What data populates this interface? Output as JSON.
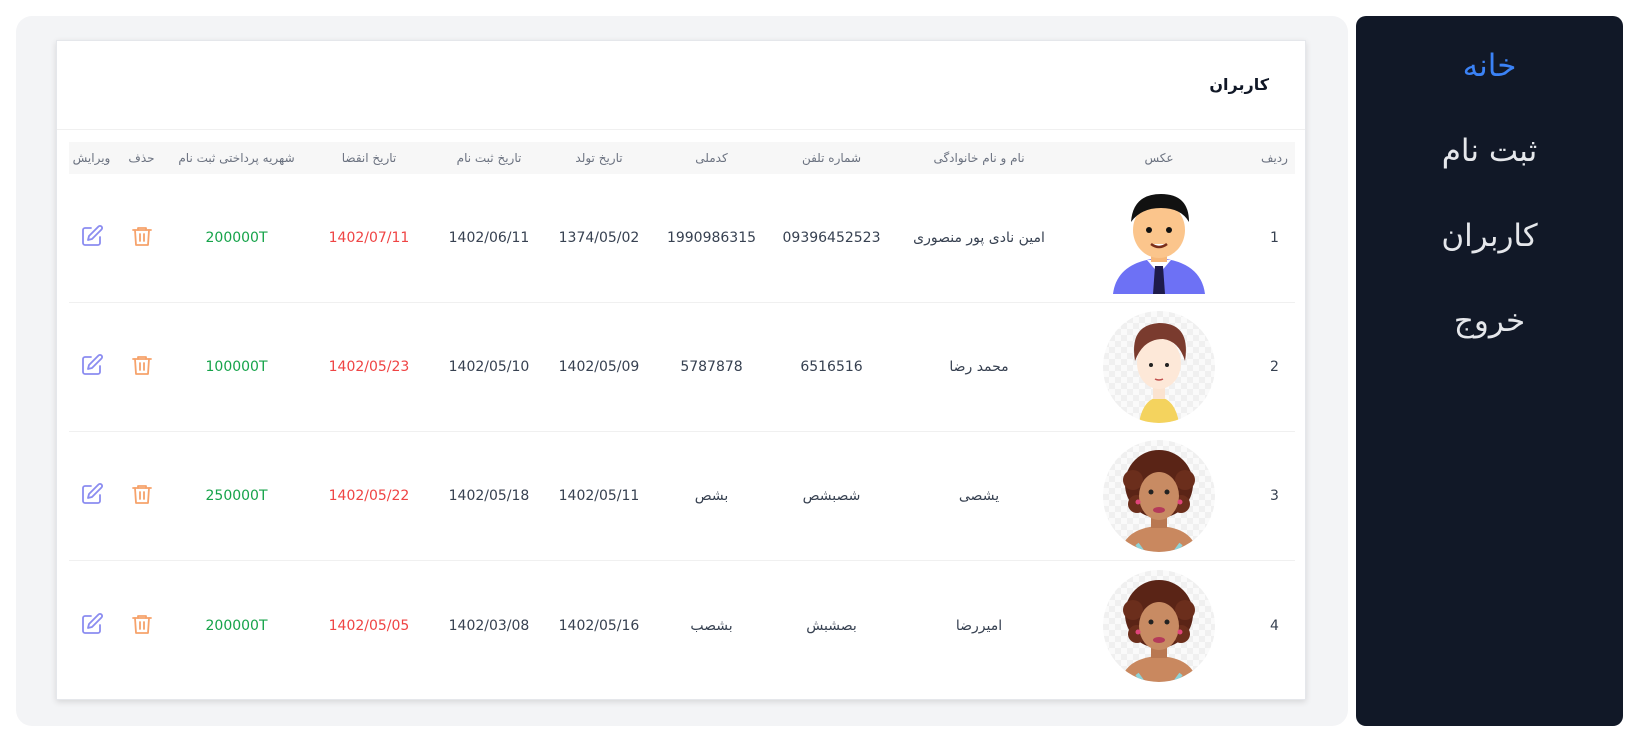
{
  "sidebar": {
    "items": [
      {
        "label": "خانه",
        "active": true
      },
      {
        "label": "ثبت نام",
        "active": false
      },
      {
        "label": "کاربران",
        "active": false
      },
      {
        "label": "خروج",
        "active": false
      }
    ]
  },
  "card": {
    "title": "کاربران"
  },
  "table": {
    "headers": {
      "index": "ردیف",
      "photo": "عکس",
      "name": "نام و نام خانوادگی",
      "phone": "شماره تلفن",
      "national_code": "کدملی",
      "birth_date": "تاریخ تولد",
      "registration_date": "تاریخ ثبت نام",
      "expiry_date": "تاریخ انقضا",
      "fee": "شهریه پرداختی ثبت نام",
      "delete": "حذف",
      "edit": "ویرایش"
    },
    "rows": [
      {
        "index": "1",
        "avatar": "man-avatar",
        "name": "امین نادی پور منصوری",
        "phone": "09396452523",
        "national_code": "1990986315",
        "birth_date": "1374/05/02",
        "registration_date": "1402/06/11",
        "expiry_date": "1402/07/11",
        "fee": "200000T"
      },
      {
        "index": "2",
        "avatar": "boy-avatar",
        "name": "محمد رضا",
        "phone": "6516516",
        "national_code": "5787878",
        "birth_date": "1402/05/09",
        "registration_date": "1402/05/10",
        "expiry_date": "1402/05/23",
        "fee": "100000T"
      },
      {
        "index": "3",
        "avatar": "curly-woman-avatar",
        "name": "یشصی",
        "phone": "شصبشص",
        "national_code": "بشص",
        "birth_date": "1402/05/11",
        "registration_date": "1402/05/18",
        "expiry_date": "1402/05/22",
        "fee": "250000T"
      },
      {
        "index": "4",
        "avatar": "curly-woman-avatar",
        "name": "امیررضا",
        "phone": "بصشبش",
        "national_code": "بشصب",
        "birth_date": "1402/05/16",
        "registration_date": "1402/03/08",
        "expiry_date": "1402/05/05",
        "fee": "200000T"
      }
    ]
  },
  "colors": {
    "sidebar_bg": "#111827",
    "active_nav": "#3b82f6",
    "fee_text": "#16a34a",
    "expiry_text": "#ef4444",
    "edit_icon": "#8b8cf0",
    "delete_icon": "#f6a26b"
  },
  "icons": {
    "edit": "edit-icon",
    "delete": "trash-icon"
  }
}
